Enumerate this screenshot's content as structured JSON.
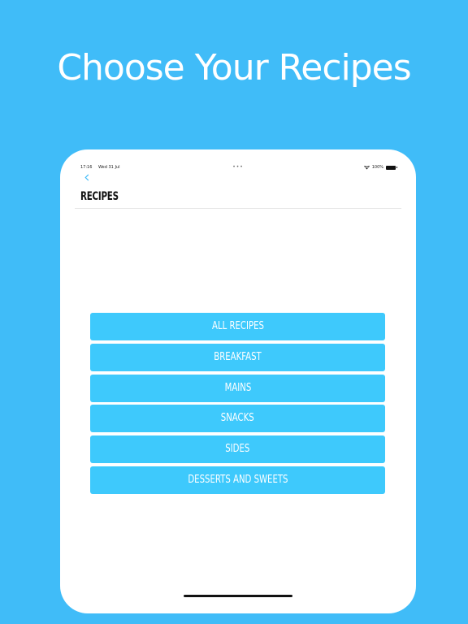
{
  "headline": "Choose Your Recipes",
  "status_bar": {
    "time": "17:16",
    "date": "Wed 31 Jul",
    "dots": "•••",
    "battery": "100%"
  },
  "nav": {
    "back_icon": "chevron-left-icon",
    "title": "RECIPES"
  },
  "menu": {
    "items": [
      {
        "label": "ALL RECIPES"
      },
      {
        "label": "BREAKFAST"
      },
      {
        "label": "MAINS"
      },
      {
        "label": "SNACKS"
      },
      {
        "label": "SIDES"
      },
      {
        "label": "DESSERTS AND SWEETS"
      }
    ]
  },
  "colors": {
    "background": "#40bcf8",
    "button": "#3ec9fc",
    "button_text": "#ffffff"
  }
}
